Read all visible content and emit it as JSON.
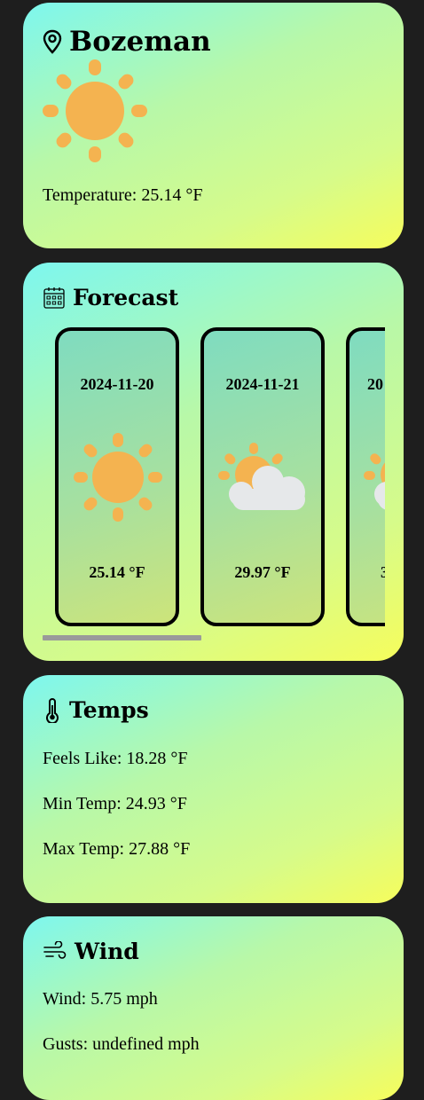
{
  "location": {
    "city": "Bozeman",
    "icon": "location-pin-icon",
    "condition_icon": "sun-icon",
    "temperature_text": "Temperature: 25.14 °F"
  },
  "forecast": {
    "title": "Forecast",
    "icon": "calendar-icon",
    "items": [
      {
        "date": "2024-11-20",
        "icon": "sun-icon",
        "temp": "25.14 °F"
      },
      {
        "date": "2024-11-21",
        "icon": "partly-cloudy-icon",
        "temp": "29.97 °F"
      },
      {
        "date": "20",
        "icon": "partly-cloudy-icon",
        "temp": "3"
      }
    ]
  },
  "temps": {
    "title": "Temps",
    "icon": "thermometer-icon",
    "feels_like": "Feels Like: 18.28 °F",
    "min_temp": "Min Temp: 24.93 °F",
    "max_temp": "Max Temp: 27.88 °F"
  },
  "wind": {
    "title": "Wind",
    "icon": "wind-icon",
    "wind_text": "Wind: 5.75 mph",
    "gusts_text": "Gusts: undefined mph"
  },
  "colors": {
    "page_bg": "#1e1e1e",
    "sun": "#f4b350",
    "cloud": "#e6e8ea",
    "card_gradient_start": "#7df7ef",
    "card_gradient_end": "#f6fd5c"
  }
}
